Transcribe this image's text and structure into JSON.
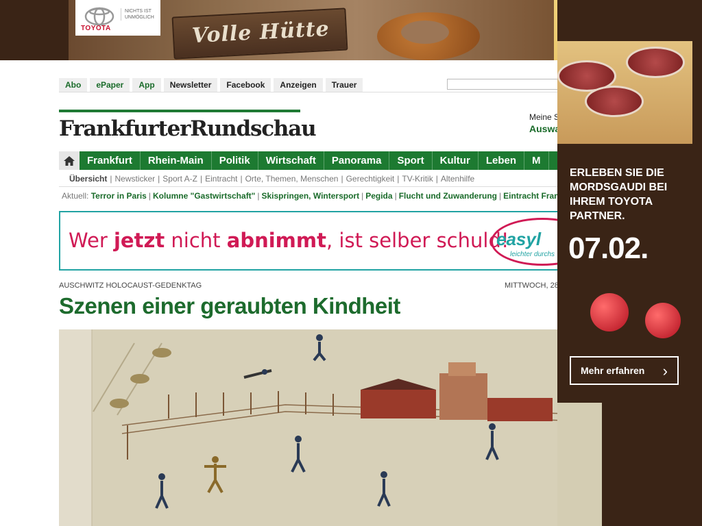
{
  "top_ad": {
    "brand": "TOYOTA",
    "slogan": "NICHTS IST UNMÖGLICH",
    "sign_text": "Volle Hütte"
  },
  "side_ad": {
    "headline": "ERLEBEN SIE DIE MORDSGAUDI BEI IHREM TOYOTA PARTNER.",
    "date": "07.02.",
    "cta": "Mehr erfahren"
  },
  "service_nav": [
    "Abo",
    "ePaper",
    "App",
    "Newsletter",
    "Facebook",
    "Anzeigen",
    "Trauer"
  ],
  "search": {
    "placeholder": ""
  },
  "logo": "FrankfurterRundschau",
  "meine": {
    "label": "Meine S",
    "value": "Auswa"
  },
  "main_nav": [
    "Frankfurt",
    "Rhein-Main",
    "Politik",
    "Wirtschaft",
    "Panorama",
    "Sport",
    "Kultur",
    "Leben",
    "M"
  ],
  "sub_nav": [
    "Übersicht",
    "Newsticker",
    "Sport A-Z",
    "Eintracht",
    "Orte, Themen, Menschen",
    "Gerechtigkeit",
    "TV-Kritik",
    "Altenhilfe"
  ],
  "aktuell": {
    "label": "Aktuell:",
    "topics": [
      "Terror in Paris",
      "Kolumne \"Gastwirtschaft\"",
      "Skispringen, Wintersport",
      "Pegida",
      "Flucht und Zuwanderung",
      "Eintracht Frankfur"
    ]
  },
  "inline_ad": {
    "w1": "Wer ",
    "w2": "jetzt",
    "w3": " nicht ",
    "w4": "abnimmt",
    "w5": ", ist selber schuld!",
    "brand": "easyl",
    "brand_sub": "leichter durchs"
  },
  "article": {
    "kicker": "AUSCHWITZ HOLOCAUST-GEDENKTAG",
    "date": "MITTWOCH, 28.",
    "headline": "Szenen einer geraubten Kindheit"
  },
  "colors": {
    "brand_green": "#1d7a31",
    "ad_pink": "#d01a55",
    "ad_teal": "#21a3a3",
    "ad_brown": "#3a2416"
  }
}
